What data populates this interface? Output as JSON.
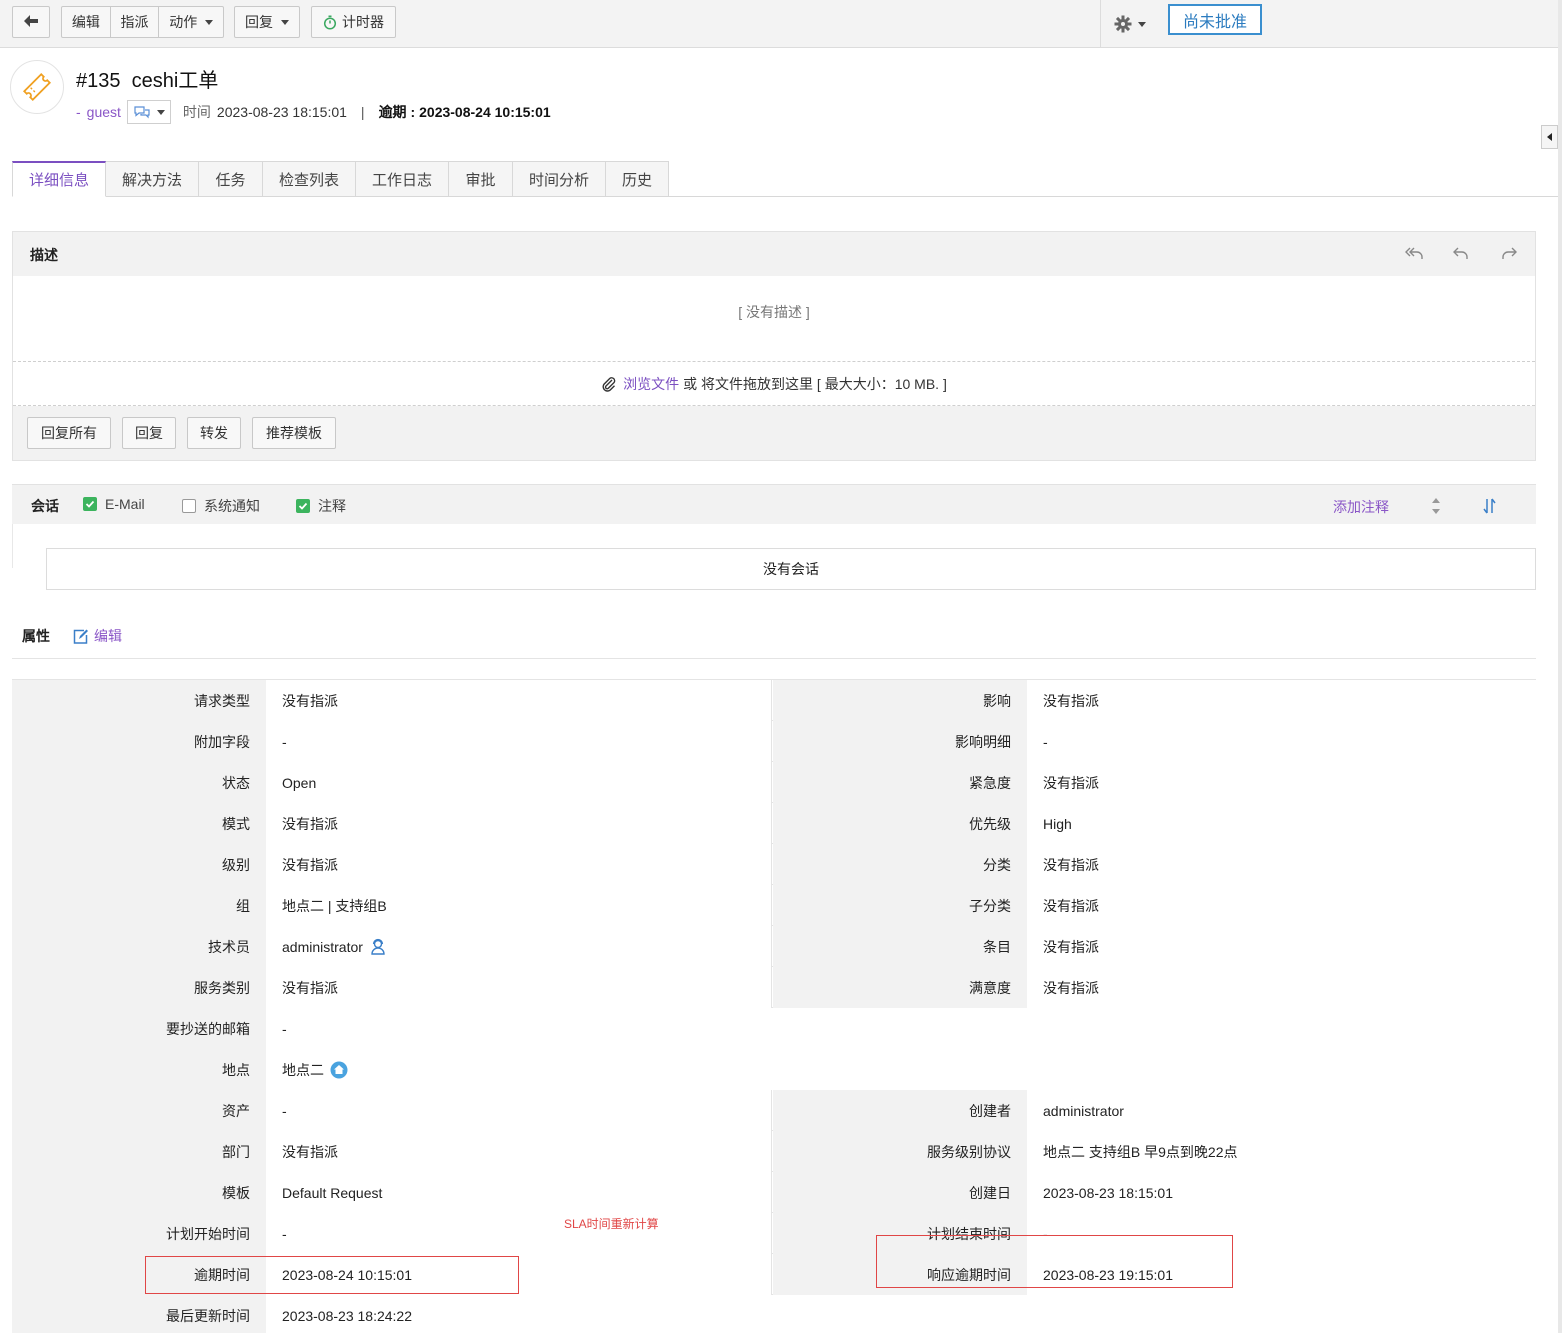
{
  "toolbar": {
    "back_icon": "arrow-left-icon",
    "edit": "编辑",
    "assign": "指派",
    "actions": "动作",
    "reply": "回复",
    "timer": "计时器",
    "settings_icon": "gear-icon",
    "approval_status": "尚未批准"
  },
  "header": {
    "ticket_icon": "ticket-icon",
    "id": "#135",
    "subject": "ceshi工单",
    "requester_prefix": "-",
    "requester": "guest",
    "time_label": "时间",
    "time_value": "2023-08-23 18:15:01",
    "separator": "|",
    "due_label": "逾期 :",
    "due_value": "2023-08-24 10:15:01"
  },
  "tabs": [
    "详细信息",
    "解决方法",
    "任务",
    "检查列表",
    "工作日志",
    "审批",
    "时间分析",
    "历史"
  ],
  "description": {
    "title": "描述",
    "empty": "[ 没有描述 ]",
    "attach_link": "浏览文件",
    "attach_text": "或 将文件拖放到这里 [ 最大大小：10 MB. ]",
    "buttons": [
      "回复所有",
      "回复",
      "转发",
      "推荐模板"
    ]
  },
  "conversation": {
    "title": "会话",
    "filters": [
      {
        "label": "E-Mail",
        "checked": true
      },
      {
        "label": "系统通知",
        "checked": false
      },
      {
        "label": "注释",
        "checked": true
      }
    ],
    "add_note": "添加注释",
    "empty": "没有会话"
  },
  "properties": {
    "title": "属性",
    "edit": "编辑",
    "rows": [
      {
        "l": "请求类型",
        "lv": "没有指派",
        "r": "影响",
        "rv": "没有指派"
      },
      {
        "l": "附加字段",
        "lv": "-",
        "r": "影响明细",
        "rv": "-"
      },
      {
        "l": "状态",
        "lv": "Open",
        "r": "紧急度",
        "rv": "没有指派"
      },
      {
        "l": "模式",
        "lv": "没有指派",
        "r": "优先级",
        "rv": "High"
      },
      {
        "l": "级别",
        "lv": "没有指派",
        "r": "分类",
        "rv": "没有指派"
      },
      {
        "l": "组",
        "lv": "地点二 | 支持组B",
        "r": "子分类",
        "rv": "没有指派"
      },
      {
        "l": "技术员",
        "lv": "administrator",
        "r": "条目",
        "rv": "没有指派"
      },
      {
        "l": "服务类别",
        "lv": "没有指派",
        "r": "满意度",
        "rv": "没有指派"
      },
      {
        "l": "要抄送的邮箱",
        "lv": "-"
      },
      {
        "l": "地点",
        "lv": "地点二"
      },
      {
        "l": "资产",
        "lv": "-",
        "r": "创建者",
        "rv": "administrator"
      },
      {
        "l": "部门",
        "lv": "没有指派",
        "r": "服务级别协议",
        "rv": "地点二 支持组B 早9点到晚22点"
      },
      {
        "l": "模板",
        "lv": "Default Request",
        "r": "创建日",
        "rv": "2023-08-23 18:15:01"
      },
      {
        "l": "计划开始时间",
        "lv": "-",
        "r": "计划结束时间",
        "rv": "-"
      },
      {
        "l": "逾期时间",
        "lv": "2023-08-24 10:15:01",
        "r": "响应逾期时间",
        "rv": "2023-08-23 19:15:01"
      },
      {
        "l": "最后更新时间",
        "lv": "2023-08-23 18:24:22"
      }
    ]
  },
  "annotation": {
    "note": "SLA时间重新计算",
    "color": "#e04646"
  },
  "colors": {
    "accent": "#7b4fc1",
    "approve_border": "#3a8fcf",
    "check_green": "#3cb45e"
  }
}
